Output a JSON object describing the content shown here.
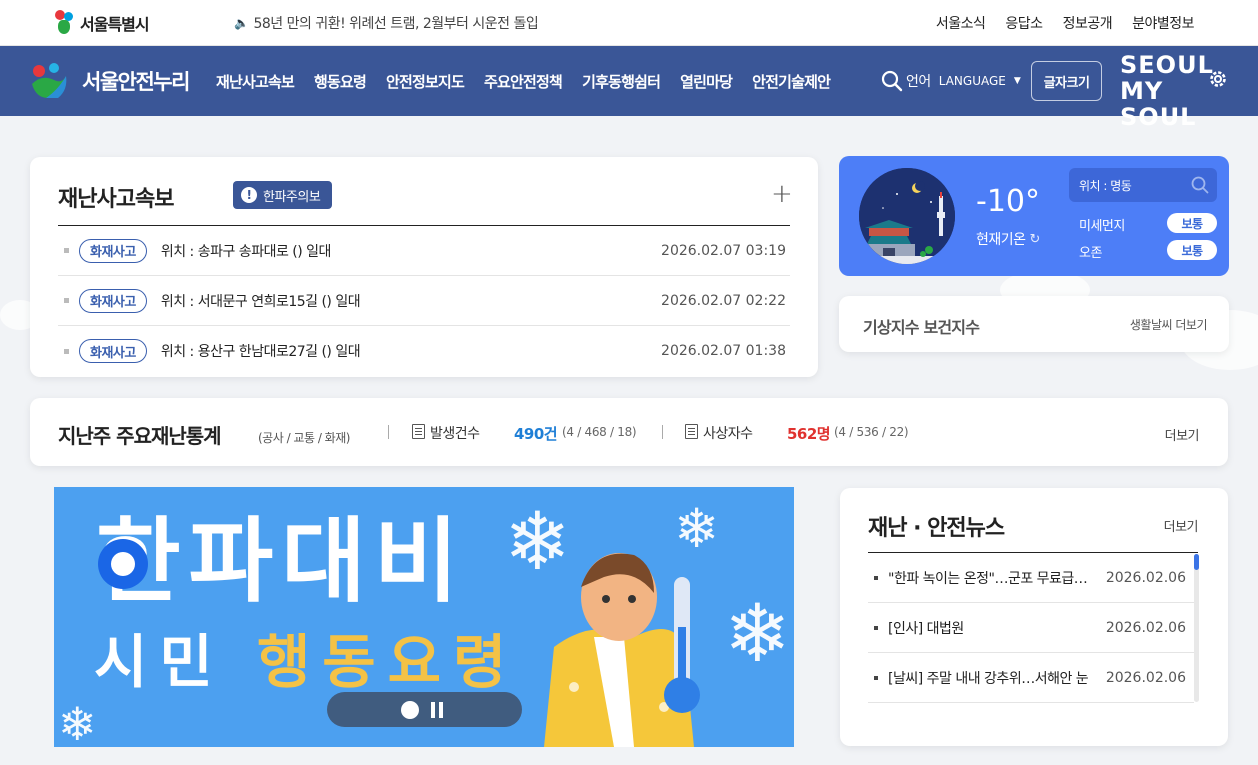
{
  "topbar": {
    "seoul_logo_text": "서울특별시",
    "notice": "58년 만의 귀환! 위례선 트램, 2월부터 시운전 돌입",
    "links": [
      "서울소식",
      "응답소",
      "정보공개",
      "분야별정보"
    ]
  },
  "nav": {
    "site_title": "서울안전누리",
    "menu": [
      "재난사고속보",
      "행동요령",
      "안전정보지도",
      "주요안전정책",
      "기후동행쉼터",
      "열린마당",
      "안전기술제안"
    ],
    "lang_ko": "언어",
    "lang_en": "LANGUAGE",
    "fontsize_label": "글자크기",
    "brand_row1": "SEOUL",
    "brand_row2": "MY SOUL"
  },
  "bulletin": {
    "title": "재난사고속보",
    "alert": "한파주의보",
    "rows": [
      {
        "tag": "화재사고",
        "location": "위치 : 송파구 송파대로 () 일대",
        "date": "2026.02.07 03:19"
      },
      {
        "tag": "화재사고",
        "location": "위치 : 서대문구 연희로15길 () 일대",
        "date": "2026.02.07 02:22"
      },
      {
        "tag": "화재사고",
        "location": "위치 : 용산구 한남대로27길 () 일대",
        "date": "2026.02.07 01:38"
      }
    ]
  },
  "weather": {
    "temperature": "-10°",
    "current_label": "현재기온",
    "location_label": "위치 : 명동",
    "indicators": [
      {
        "label": "미세먼지",
        "status": "보통"
      },
      {
        "label": "오존",
        "status": "보통"
      }
    ],
    "accent": "#4d7ef7"
  },
  "indexes": {
    "label": "기상지수 보건지수",
    "more": "생활날씨 더보기"
  },
  "stats": {
    "title": "지난주 주요재난통계",
    "subtitle": "(공사 / 교통 / 화재)",
    "occurrence_label": "발생건수",
    "occurrence_value": "490건",
    "occurrence_detail": "(4 / 468 / 18)",
    "casualty_label": "사상자수",
    "casualty_value": "562명",
    "casualty_detail": "(4 / 536 / 22)",
    "more": "더보기",
    "occurrence_color": "#1f7fd6",
    "casualty_color": "#e0322f"
  },
  "banner": {
    "headline": "한파대비",
    "sub_part1": "시민",
    "sub_part2": "행동요령"
  },
  "news": {
    "title": "재난 · 안전뉴스",
    "more": "더보기",
    "items": [
      {
        "title": "\"한파 녹이는 온정\"…군포 무료급식소",
        "date": "2026.02.06"
      },
      {
        "title": "[인사] 대법원",
        "date": "2026.02.06"
      },
      {
        "title": "[날씨] 주말 내내 강추위…서해안 눈",
        "date": "2026.02.06"
      }
    ]
  }
}
